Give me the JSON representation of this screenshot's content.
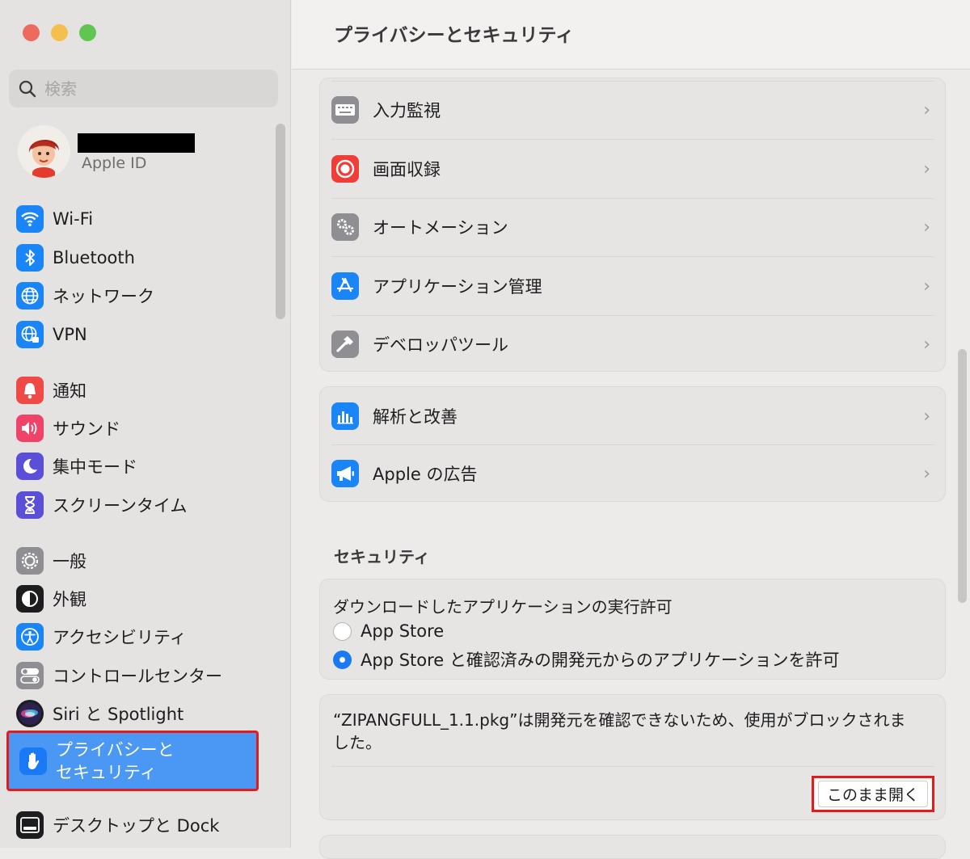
{
  "window": {
    "title": "プライバシーとセキュリティ"
  },
  "search": {
    "placeholder": "検索"
  },
  "account": {
    "label": "Apple ID"
  },
  "sidebar": {
    "items": [
      {
        "label": "Wi-Fi",
        "icon": "wifi-icon"
      },
      {
        "label": "Bluetooth",
        "icon": "bluetooth-icon"
      },
      {
        "label": "ネットワーク",
        "icon": "globe-icon"
      },
      {
        "label": "VPN",
        "icon": "vpn-globe-icon"
      },
      {
        "label": "通知",
        "icon": "bell-icon"
      },
      {
        "label": "サウンド",
        "icon": "speaker-icon"
      },
      {
        "label": "集中モード",
        "icon": "moon-icon"
      },
      {
        "label": "スクリーンタイム",
        "icon": "hourglass-icon"
      },
      {
        "label": "一般",
        "icon": "gear-icon"
      },
      {
        "label": "外観",
        "icon": "appearance-icon"
      },
      {
        "label": "アクセシビリティ",
        "icon": "accessibility-icon"
      },
      {
        "label": "コントロールセンター",
        "icon": "toggles-icon"
      },
      {
        "label": "Siri と Spotlight",
        "icon": "siri-icon"
      },
      {
        "label": "プライバシーと\nセキュリティ",
        "icon": "hand-icon"
      },
      {
        "label": "デスクトップと Dock",
        "icon": "dock-icon"
      }
    ]
  },
  "privacy_rows": [
    {
      "label": "入力監視",
      "icon": "keyboard-icon"
    },
    {
      "label": "画面収録",
      "icon": "record-icon"
    },
    {
      "label": "オートメーション",
      "icon": "gears-icon"
    },
    {
      "label": "アプリケーション管理",
      "icon": "app-store-icon"
    },
    {
      "label": "デベロッパツール",
      "icon": "hammer-icon"
    }
  ],
  "analytics_rows": [
    {
      "label": "解析と改善",
      "icon": "chart-icon"
    },
    {
      "label": "Apple の広告",
      "icon": "megaphone-icon"
    }
  ],
  "security": {
    "section_title": "セキュリティ",
    "download_title": "ダウンロードしたアプリケーションの実行許可",
    "option_app_store": "App Store",
    "option_identified": "App Store と確認済みの開発元からのアプリケーションを許可",
    "selected_option": "option_identified",
    "blocked_message": "“ZIPANGFULL_1.1.pkg”は開発元を確認できないため、使用がブロックされました。",
    "open_anyway_label": "このまま開く"
  },
  "colors": {
    "selection": "#4a97f4",
    "highlight_border": "#e41b1b",
    "accent": "#1a7af5"
  }
}
